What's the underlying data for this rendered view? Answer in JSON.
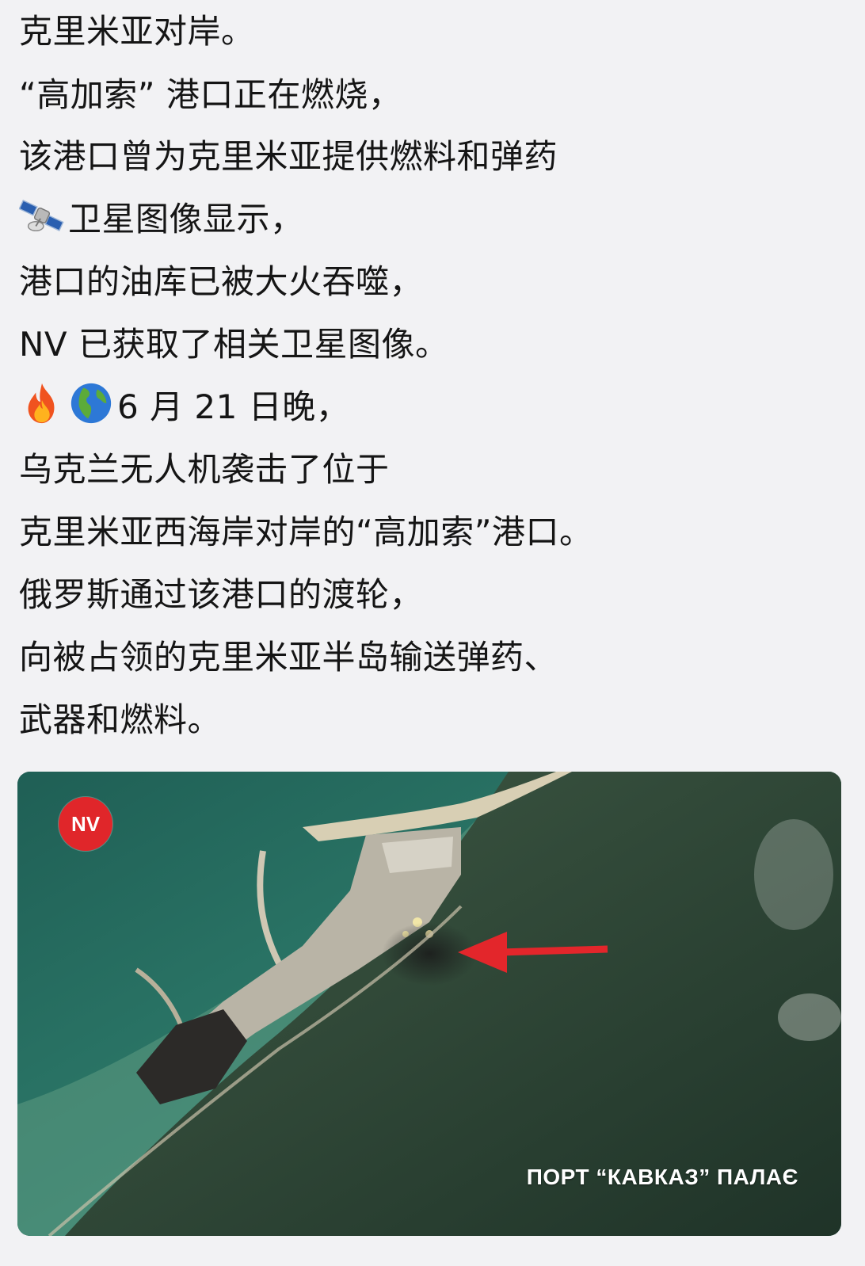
{
  "post": {
    "lines": [
      "克里米亚对岸。",
      "“高加索” 港口正在燃烧，",
      "该港口曾为克里米亚提供燃料和弹药",
      "卫星图像显示，",
      "港口的油库已被大火吞噬，",
      "NV 已获取了相关卫星图像。",
      "6 月 21 日晚，",
      "乌克兰无人机袭击了位于",
      "克里米亚西海岸对岸的“高加索”港口。",
      "俄罗斯通过该港口的渡轮，",
      "向被占领的克里米亚半岛输送弹药、",
      "武器和燃料。"
    ],
    "icons": [
      "satellite-emoji",
      "fire-emoji",
      "globe-emoji"
    ]
  },
  "image": {
    "logo_text": "NV",
    "caption": "ПОРТ “КАВКАЗ” ПАЛАЄ",
    "arrow_color": "#e3262b"
  }
}
